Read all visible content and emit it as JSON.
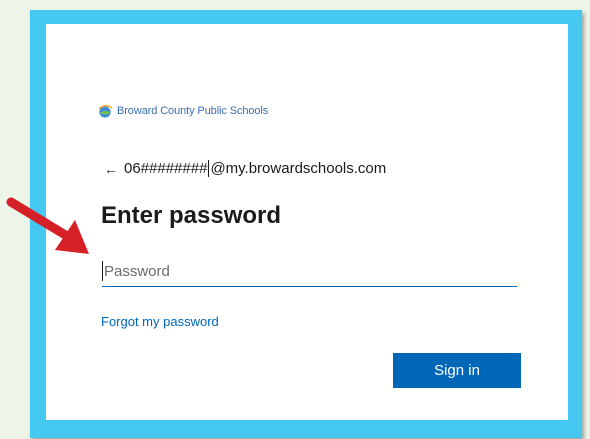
{
  "logo": {
    "text": "Broward County Public Schools"
  },
  "identity": {
    "back_arrow": "←",
    "username_prefix": "06########",
    "username_domain": "@my.browardschools.com"
  },
  "heading": {
    "title": "Enter password"
  },
  "password": {
    "placeholder": "Password",
    "value": ""
  },
  "links": {
    "forgot": "Forgot my password"
  },
  "actions": {
    "sign_in": "Sign in"
  },
  "colors": {
    "frame": "#45c8f1",
    "accent": "#0067b8",
    "annotation_arrow": "#d42026",
    "background": "#edf4e8"
  },
  "icons": {
    "logo": "broward-globe-icon",
    "back": "back-arrow-icon",
    "annotation": "red-pointer-arrow-icon"
  }
}
